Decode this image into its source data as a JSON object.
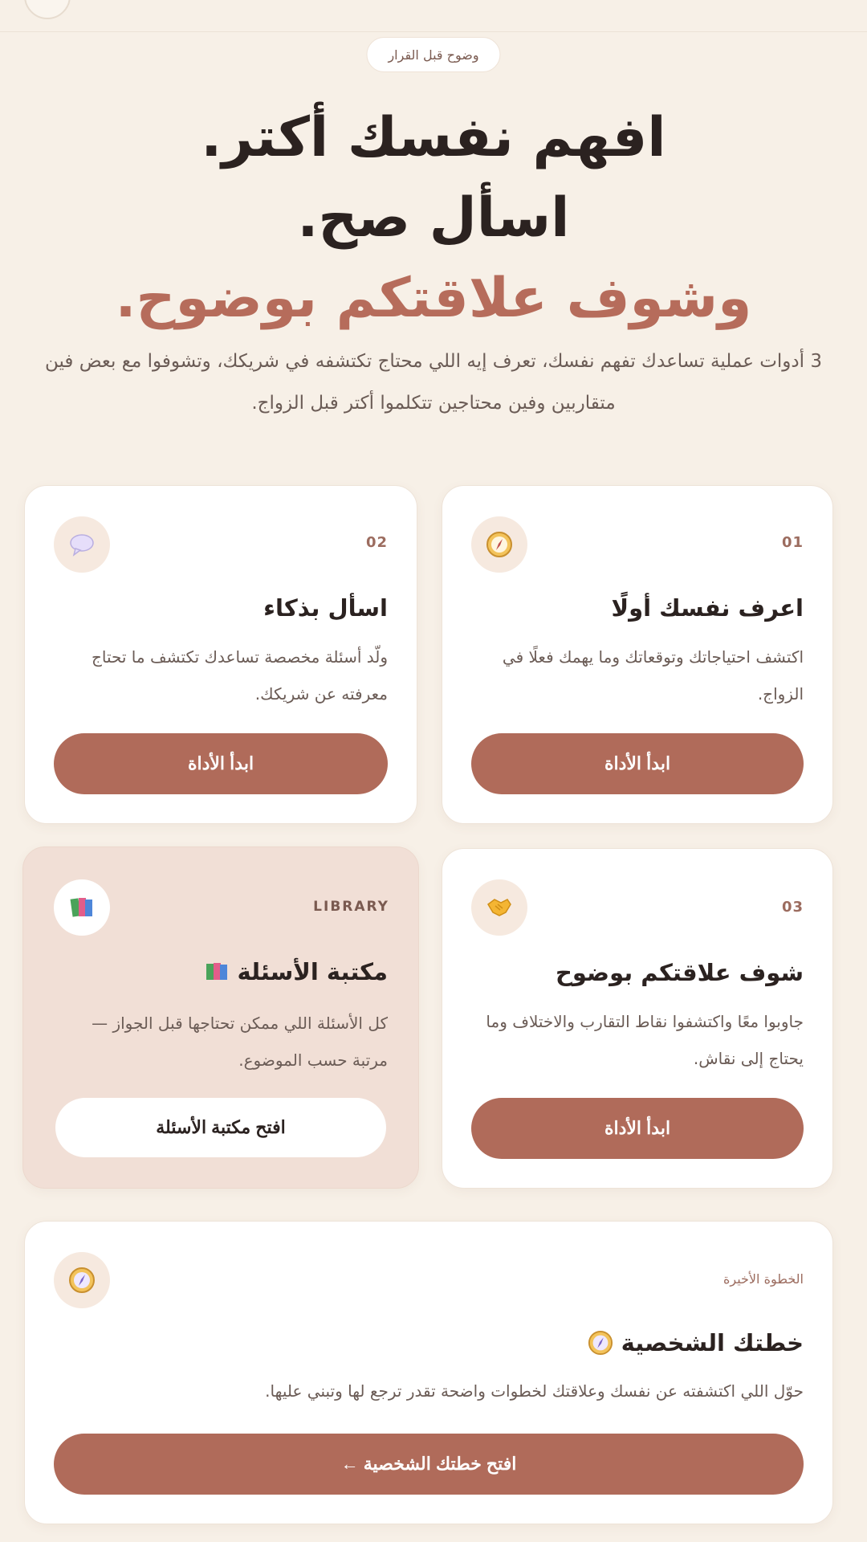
{
  "header": {
    "badge": "وضوح قبل القرار"
  },
  "hero": {
    "line1": "افهم نفسك أكتر.",
    "line2": "اسأل صح.",
    "line3": "وشوف علاقتكم بوضوح.",
    "subtitle": "3 أدوات عملية تساعدك تفهم نفسك، تعرف إيه اللي محتاج تكتشفه في شريكك، وتشوفوا مع بعض فين متقاربين وفين محتاجين تتكلموا أكتر قبل الزواج."
  },
  "cards": [
    {
      "number": "01",
      "icon": "compass-icon",
      "title": "اعرف نفسك أولًا",
      "description": "اكتشف احتياجاتك وتوقعاتك وما يهمك فعلًا في الزواج.",
      "button": "ابدأ الأداة"
    },
    {
      "number": "02",
      "icon": "speech-bubble-icon",
      "title": "اسأل بذكاء",
      "description": "ولّد أسئلة مخصصة تساعدك تكتشف ما تحتاج معرفته عن شريكك.",
      "button": "ابدأ الأداة"
    },
    {
      "number": "03",
      "icon": "handshake-icon",
      "title": "شوف علاقتكم بوضوح",
      "description": "جاوبوا معًا واكتشفوا نقاط التقارب والاختلاف وما يحتاج إلى نقاش.",
      "button": "ابدأ الأداة"
    }
  ],
  "library": {
    "tag": "LIBRARY",
    "icon": "books-icon",
    "title": "مكتبة الأسئلة",
    "description": "كل الأسئلة اللي ممكن تحتاجها قبل الجواز — مرتبة حسب الموضوع.",
    "button": "افتح مكتبة الأسئلة"
  },
  "plan": {
    "tag": "الخطوة الأخيرة",
    "icon": "compass-icon",
    "title": "خطتك الشخصية",
    "description": "حوّل اللي اكتشفته عن نفسك وعلاقتك لخطوات واضحة تقدر ترجع لها وتبني عليها.",
    "button": "افتح خطتك الشخصية ←"
  },
  "colors": {
    "background": "#f7f0e7",
    "accent": "#b06b5a",
    "accent_text": "#b66c5b",
    "library_card": "#f1dfd6"
  }
}
